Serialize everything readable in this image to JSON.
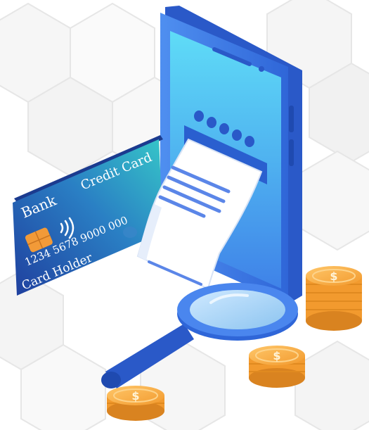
{
  "card": {
    "bank": "Bank",
    "type": "Credit Card",
    "number_partial": "1234  5678  9000  000",
    "holder": "Card Holder"
  },
  "coins": {
    "currency_symbol": "$"
  },
  "colors": {
    "phone_blue": "#3f7fe6",
    "screen_cyan": "#58d6f5",
    "card_teal": "#2fb7c0",
    "card_navy": "#1f3f9e",
    "coin_gold": "#f6a93b",
    "chip_orange": "#f29a38",
    "receipt_lines": "#5b86e8",
    "magnifier_blue": "#2f66d8"
  }
}
